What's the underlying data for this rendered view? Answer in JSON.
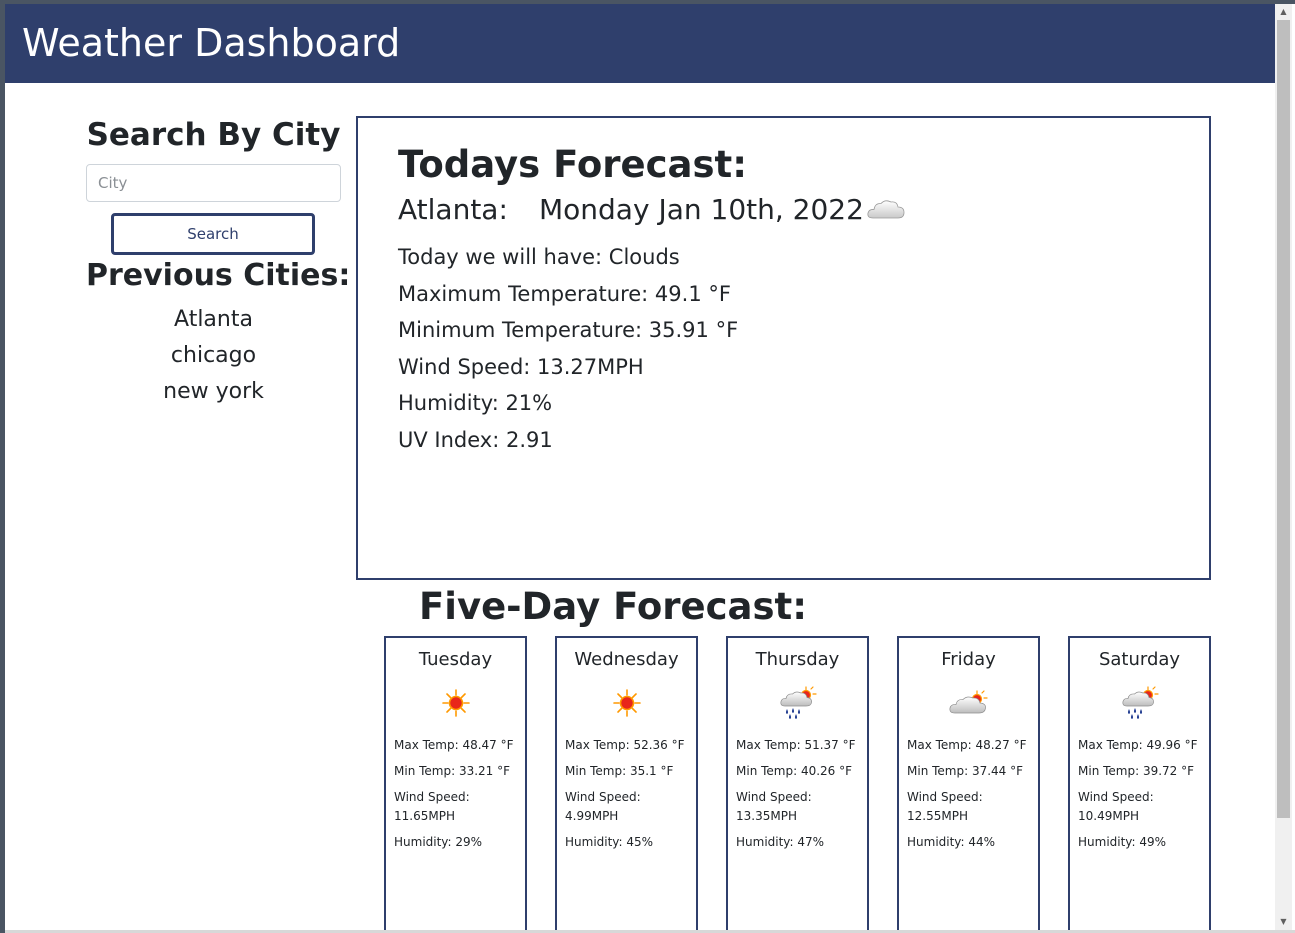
{
  "header": {
    "title": "Weather Dashboard"
  },
  "sidebar": {
    "title": "Search By City",
    "input_placeholder": "City",
    "input_value": "",
    "search_label": "Search",
    "previous_title": "Previous Cities:",
    "previous_cities": [
      "Atlanta",
      "chicago",
      "new york"
    ]
  },
  "today": {
    "title": "Todays Forecast:",
    "city": "Atlanta:",
    "date": "Monday Jan 10th, 2022",
    "icon": "cloud-icon",
    "lines": [
      "Today we will have: Clouds",
      "Maximum Temperature: 49.1 °F",
      "Minimum Temperature: 35.91 °F",
      "Wind Speed: 13.27MPH",
      "Humidity: 21%",
      "UV Index: 2.91"
    ]
  },
  "five_day": {
    "title": "Five-Day Forecast:",
    "days": [
      {
        "name": "Tuesday",
        "icon": "sun-icon",
        "max": "Max Temp: 48.47 °F",
        "min": "Min Temp: 33.21 °F",
        "wind_label": "Wind Speed:",
        "wind_value": "11.65MPH",
        "humidity": "Humidity: 29%"
      },
      {
        "name": "Wednesday",
        "icon": "sun-icon",
        "max": "Max Temp: 52.36 °F",
        "min": "Min Temp: 35.1 °F",
        "wind_label": "Wind Speed:",
        "wind_value": "4.99MPH",
        "humidity": "Humidity: 45%"
      },
      {
        "name": "Thursday",
        "icon": "rain-sun-icon",
        "max": "Max Temp: 51.37 °F",
        "min": "Min Temp: 40.26 °F",
        "wind_label": "Wind Speed:",
        "wind_value": "13.35MPH",
        "humidity": "Humidity: 47%"
      },
      {
        "name": "Friday",
        "icon": "cloud-sun-icon",
        "max": "Max Temp: 48.27 °F",
        "min": "Min Temp: 37.44 °F",
        "wind_label": "Wind Speed:",
        "wind_value": "12.55MPH",
        "humidity": "Humidity: 44%"
      },
      {
        "name": "Saturday",
        "icon": "rain-sun-icon",
        "max": "Max Temp: 49.96 °F",
        "min": "Min Temp: 39.72 °F",
        "wind_label": "Wind Speed:",
        "wind_value": "10.49MPH",
        "humidity": "Humidity: 49%"
      }
    ]
  },
  "colors": {
    "header_bg": "#2f3f6c",
    "card_border": "#2f3f6c",
    "sun": "#ff9900",
    "sun_core": "#e8261a",
    "rain": "#1f3a8f"
  }
}
